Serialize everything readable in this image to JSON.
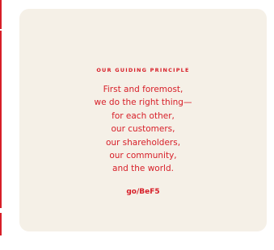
{
  "card": {
    "eyebrow": "OUR GUIDING PRINCIPLE",
    "lines": [
      "First and foremost,",
      "we do the right thing—",
      "for each other,",
      "our customers,",
      "our shareholders,",
      "our community,",
      "and the world."
    ],
    "link_label": "go/BeF5"
  },
  "colors": {
    "accent": "#d71e28",
    "card_background": "#f5f0e7"
  }
}
